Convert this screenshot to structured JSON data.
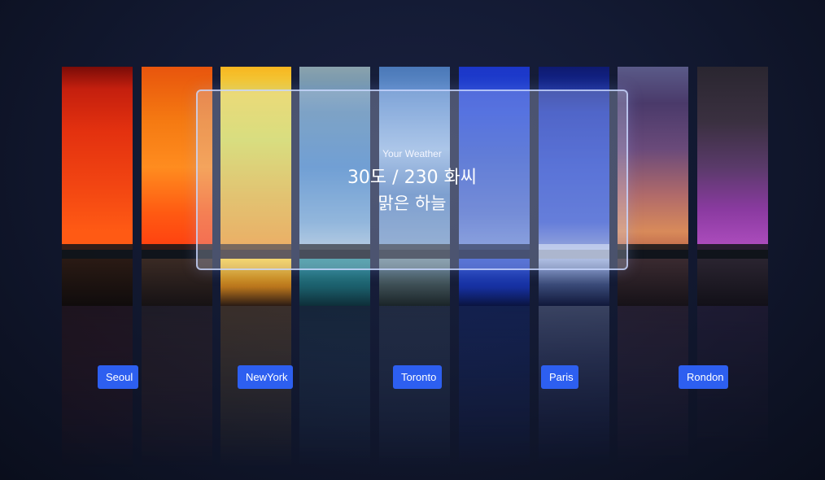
{
  "weather": {
    "label": "Your Weather",
    "temperature": "30도 / 230 화씨",
    "condition": "맑은 하늘"
  },
  "cities": [
    "Seoul",
    "NewYork",
    "Toronto",
    "Paris",
    "Rondon"
  ],
  "colors": {
    "button": "#2d5ff0",
    "background": "#131a33"
  }
}
